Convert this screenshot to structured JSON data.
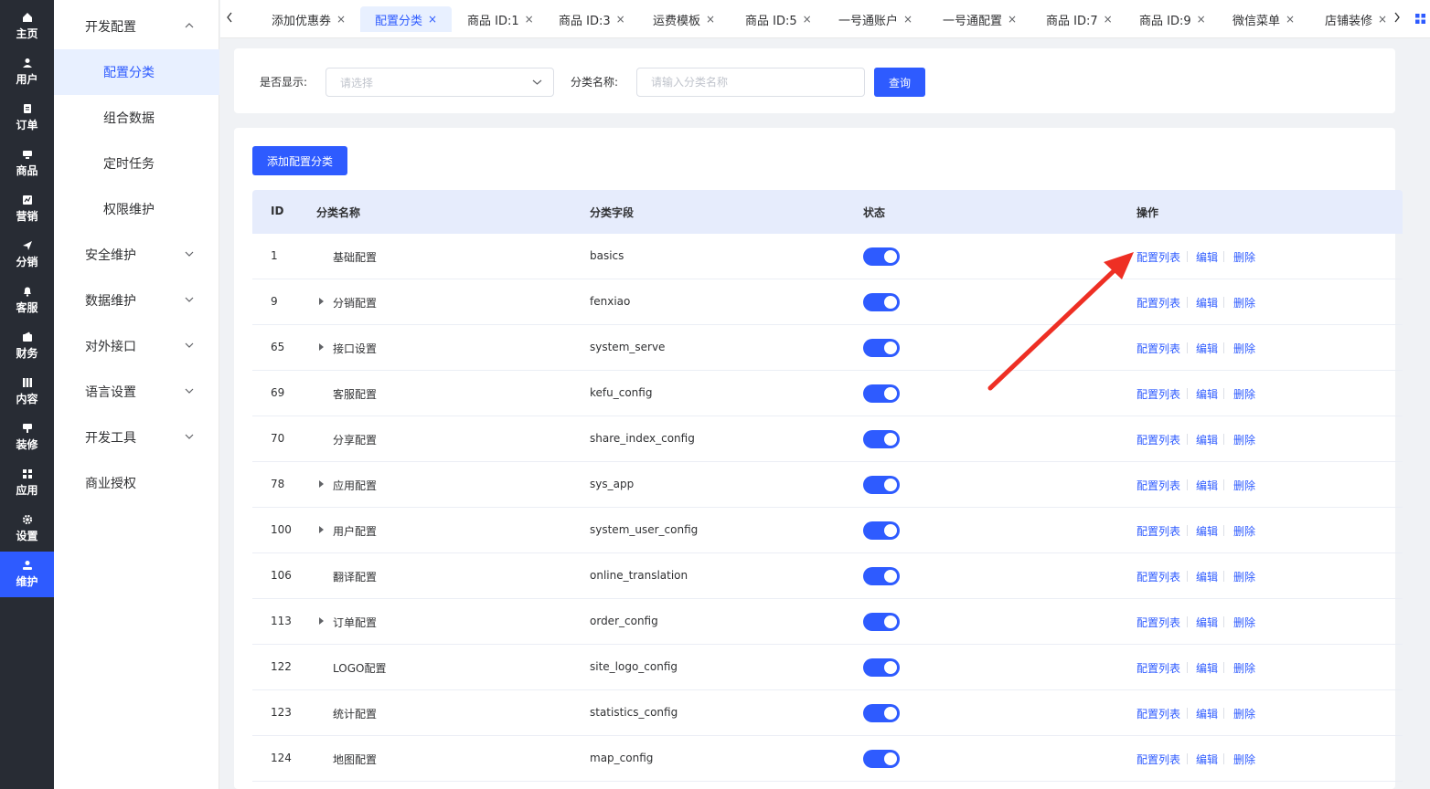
{
  "rail": [
    {
      "label": "主页",
      "icon": "home-icon"
    },
    {
      "label": "用户",
      "icon": "user-icon"
    },
    {
      "label": "订单",
      "icon": "order-icon"
    },
    {
      "label": "商品",
      "icon": "product-icon"
    },
    {
      "label": "营销",
      "icon": "marketing-icon"
    },
    {
      "label": "分销",
      "icon": "distribution-icon"
    },
    {
      "label": "客服",
      "icon": "bell-icon"
    },
    {
      "label": "财务",
      "icon": "wallet-icon"
    },
    {
      "label": "内容",
      "icon": "content-icon"
    },
    {
      "label": "装修",
      "icon": "decoration-icon"
    },
    {
      "label": "应用",
      "icon": "apps-icon"
    },
    {
      "label": "设置",
      "icon": "gear-icon"
    },
    {
      "label": "维护",
      "icon": "maintenance-icon",
      "active": true
    }
  ],
  "submenu": {
    "group_dev": "开发配置",
    "items": [
      "配置分类",
      "组合数据",
      "定时任务",
      "权限维护"
    ],
    "groups": [
      "安全维护",
      "数据维护",
      "对外接口",
      "语言设置",
      "开发工具"
    ],
    "license": "商业授权"
  },
  "tabs": [
    "添加优惠券",
    "配置分类",
    "商品 ID:1",
    "商品 ID:3",
    "运费模板",
    "商品 ID:5",
    "一号通账户",
    "一号通配置",
    "商品 ID:7",
    "商品 ID:9",
    "微信菜单",
    "店铺装修"
  ],
  "tab_close": "×",
  "search": {
    "show_label": "是否显示:",
    "show_placeholder": "请选择",
    "name_label": "分类名称:",
    "name_placeholder": "请输入分类名称",
    "query_button": "查询"
  },
  "add_button": "添加配置分类",
  "table": {
    "headers": [
      "ID",
      "分类名称",
      "分类字段",
      "状态",
      "操作"
    ],
    "actions": [
      "配置列表",
      "编辑",
      "删除"
    ],
    "rows": [
      {
        "id": "1",
        "name": "基础配置",
        "field": "basics",
        "expandable": false
      },
      {
        "id": "9",
        "name": "分销配置",
        "field": "fenxiao",
        "expandable": true
      },
      {
        "id": "65",
        "name": "接口设置",
        "field": "system_serve",
        "expandable": true
      },
      {
        "id": "69",
        "name": "客服配置",
        "field": "kefu_config",
        "expandable": false
      },
      {
        "id": "70",
        "name": "分享配置",
        "field": "share_index_config",
        "expandable": false
      },
      {
        "id": "78",
        "name": "应用配置",
        "field": "sys_app",
        "expandable": true
      },
      {
        "id": "100",
        "name": "用户配置",
        "field": "system_user_config",
        "expandable": true
      },
      {
        "id": "106",
        "name": "翻译配置",
        "field": "online_translation",
        "expandable": false
      },
      {
        "id": "113",
        "name": "订单配置",
        "field": "order_config",
        "expandable": true
      },
      {
        "id": "122",
        "name": "LOGO配置",
        "field": "site_logo_config",
        "expandable": false
      },
      {
        "id": "123",
        "name": "统计配置",
        "field": "statistics_config",
        "expandable": false
      },
      {
        "id": "124",
        "name": "地图配置",
        "field": "map_config",
        "expandable": false
      }
    ]
  },
  "colors": {
    "accent": "#2e5bff",
    "rail_bg": "#282c34",
    "arrow": "#ee2f24"
  }
}
